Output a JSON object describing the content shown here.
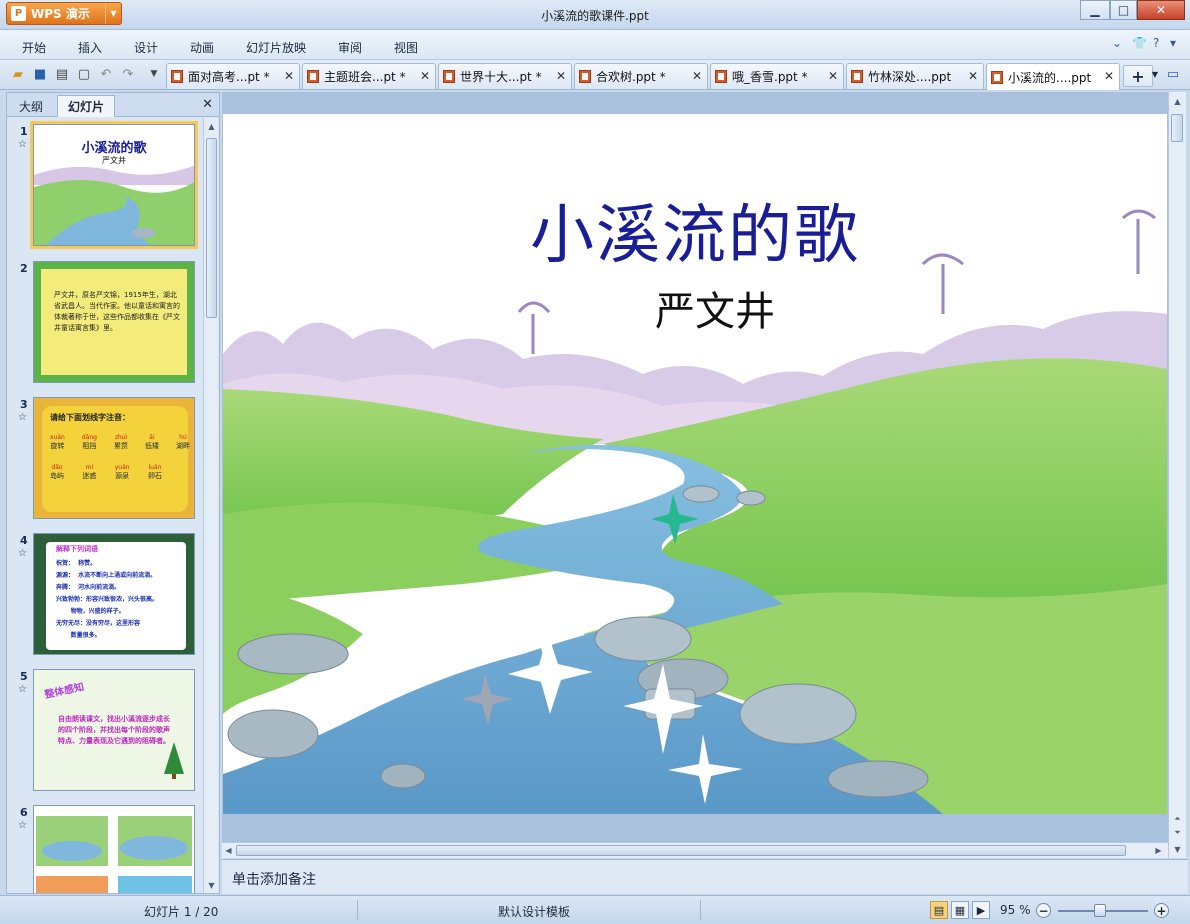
{
  "app": {
    "button_label": "WPS 演示",
    "window_title": "小溪流的歌课件.ppt"
  },
  "menu": [
    "开始",
    "插入",
    "设计",
    "动画",
    "幻灯片放映",
    "审阅",
    "视图"
  ],
  "doc_tabs": [
    {
      "label": "面对高考...pt *"
    },
    {
      "label": "主题班会...pt *"
    },
    {
      "label": "世界十大...pt *"
    },
    {
      "label": "合欢树.ppt *"
    },
    {
      "label": "哦_香雪.ppt *"
    },
    {
      "label": "竹林深处....ppt"
    },
    {
      "label": "小溪流的....ppt"
    }
  ],
  "left_panel": {
    "tab_outline": "大纲",
    "tab_slides": "幻灯片",
    "thumbs": [
      {
        "num": "1",
        "title": "小溪流的歌",
        "sub": "严文井"
      },
      {
        "num": "2",
        "text": "严文井，原名严文锦，1915年生，湖北省武昌人。当代作家。他以童话和寓言的体裁著称于世，这些作品都收集在《严文井童话寓言集》里。"
      },
      {
        "num": "3",
        "heading": "请给下面划线字注音：",
        "row1": [
          {
            "py": "xuán",
            "w": "旋转"
          },
          {
            "py": "dǎng",
            "w": "阻挡"
          },
          {
            "py": "zhuì",
            "w": "累赘"
          },
          {
            "py": "ǎi",
            "w": "低矮"
          },
          {
            "py": "hú",
            "w": "湖畔"
          }
        ],
        "row2": [
          {
            "py": "dǎo",
            "w": "岛屿"
          },
          {
            "py": "mí",
            "w": "迷惑"
          },
          {
            "py": "yuán",
            "w": "源泉"
          },
          {
            "py": "luǎn",
            "w": "卵石"
          }
        ]
      },
      {
        "num": "4",
        "heading": "解释下列词语",
        "lines": [
          "祝贺：  称赞。",
          "源源：  水流不断向上涌或向前流淌。",
          "奔腾：  河水向前流淌。",
          "兴致勃勃：形容兴致很浓，兴头很高。",
          "       物物，兴盛的样子。",
          "无穷无尽：没有穷尽，这里形容",
          "       数量很多。"
        ]
      },
      {
        "num": "5",
        "heading": "整体感知",
        "text": "自由朗读课文，找出小溪流逐步成长的四个阶段，并找出每个阶段的歌声特点、力量表现及它遇到的阻碍者。"
      },
      {
        "num": "6"
      }
    ]
  },
  "slide": {
    "title": "小溪流的歌",
    "author": "严文井"
  },
  "notes_placeholder": "单击添加备注",
  "status": {
    "slide_pos": "幻灯片 1 / 20",
    "template": "默认设计模板",
    "zoom": "95 %",
    "zoom_level": 0.95
  },
  "colors": {
    "title_blue": "#1a1e96",
    "accent_orange": "#e0731b",
    "selected_thumb": "#f6c956"
  }
}
